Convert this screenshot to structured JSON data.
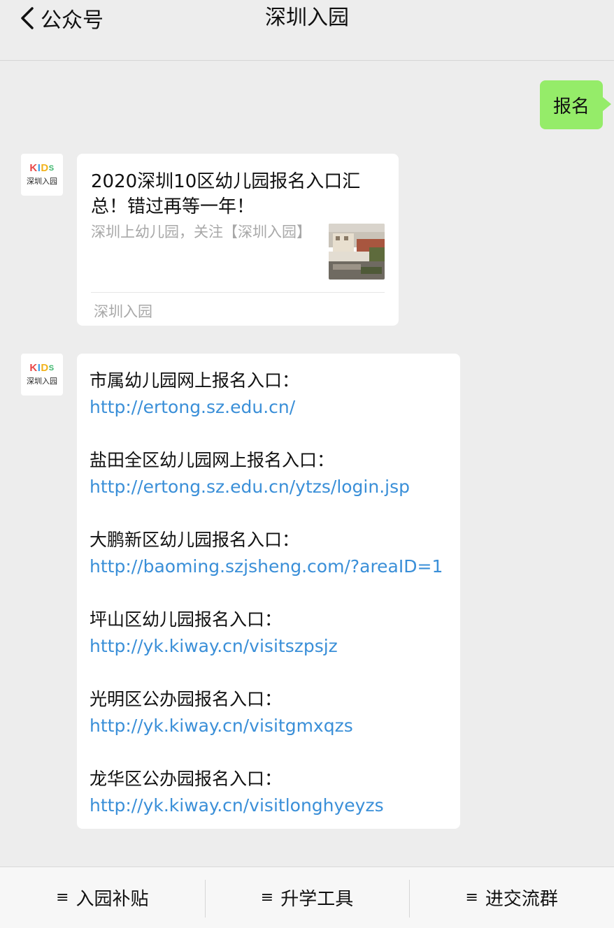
{
  "header": {
    "back_label": "公众号",
    "title": "深圳入园"
  },
  "user_message": "报名",
  "avatar": {
    "kids_letters": "KIDS",
    "caption": "深圳入园"
  },
  "article_card": {
    "title": "2020深圳10区幼儿园报名入口汇总！错过再等一年！",
    "description": "深圳上幼儿园，关注【深圳入园】",
    "source": "深圳入园"
  },
  "link_entries": [
    {
      "label": "市属幼儿园网上报名入口：",
      "url": "http://ertong.sz.edu.cn/"
    },
    {
      "label": "盐田全区幼儿园网上报名入口：",
      "url": "http://ertong.sz.edu.cn/ytzs/login.jsp"
    },
    {
      "label": "大鹏新区幼儿园报名入口：",
      "url": "http://baoming.szjsheng.com/?areaID=1"
    },
    {
      "label": "坪山区幼儿园报名入口：",
      "url": "http://yk.kiway.cn/visitszpsjz"
    },
    {
      "label": "光明区公办园报名入口：",
      "url": "http://yk.kiway.cn/visitgmxqzs"
    },
    {
      "label": "龙华区公办园报名入口：",
      "url": "http://yk.kiway.cn/visitlonghyeyzs"
    }
  ],
  "bottom_menu": [
    {
      "icon": "menu-lines-icon",
      "label": "入园补贴"
    },
    {
      "icon": "menu-lines-icon",
      "label": "升学工具"
    },
    {
      "icon": "menu-lines-icon",
      "label": "进交流群"
    }
  ],
  "colors": {
    "background": "#ededed",
    "user_bubble": "#95ec69",
    "link": "#3a8fd8",
    "muted_text": "#a8a8a8"
  }
}
